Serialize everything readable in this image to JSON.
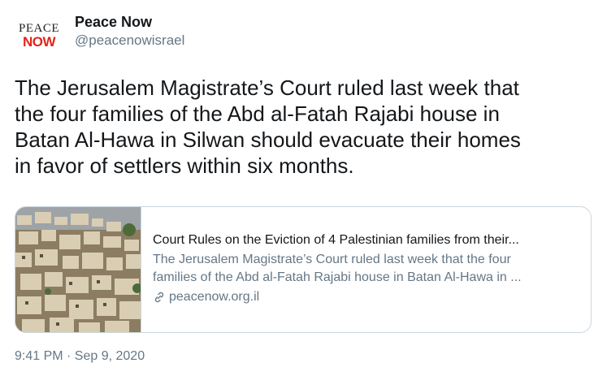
{
  "account": {
    "avatar_line1": "PEACE",
    "avatar_line2": "NOW",
    "display_name": "Peace Now",
    "handle": "@peacenowisrael"
  },
  "tweet": {
    "text": "The Jerusalem Magistrate’s Court ruled last week that\nthe four families of the Abd al-Fatah Rajabi house in\nBatan Al-Hawa in Silwan should evacuate their homes\nin favor of settlers within six months.",
    "timestamp": "9:41 PM · Sep 9, 2020"
  },
  "card": {
    "title": "Court Rules on the Eviction of 4 Palestinian families from their...",
    "description_line1": "The Jerusalem Magistrate’s Court ruled last week that the four",
    "description_line2": "families of the Abd al-Fatah Rajabi house in Batan Al-Hawa in ...",
    "domain": "peacenow.org.il",
    "link_icon": "link-icon",
    "thumbnail_icon": "hillside-houses-photo"
  },
  "colors": {
    "text_primary": "#14171a",
    "text_secondary": "#657786",
    "border": "#ccd6dd",
    "brand_red": "#e1251b"
  }
}
